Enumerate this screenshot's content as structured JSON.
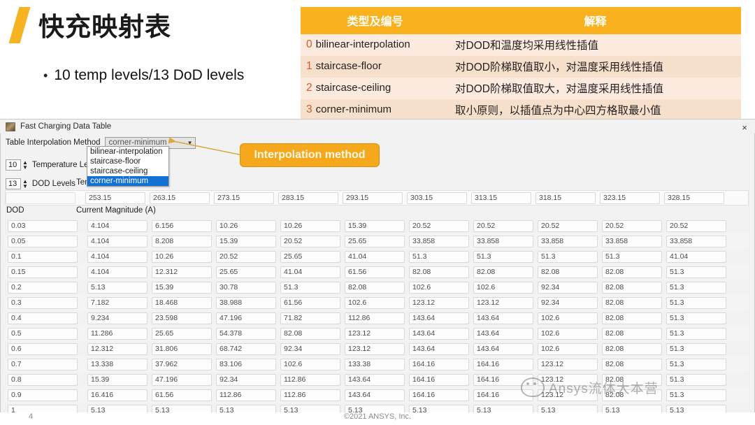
{
  "slide": {
    "title": "快充映射表",
    "bullet": "10 temp levels/13 DoD levels",
    "page_number": "4",
    "copyright": "©2021 ANSYS, Inc.",
    "accent_color": "#f6b221"
  },
  "legend": {
    "headers": [
      "类型及编号",
      "解释"
    ],
    "rows": [
      {
        "code": "0",
        "type": "bilinear-interpolation",
        "desc": "对DOD和温度均采用线性插值"
      },
      {
        "code": "1",
        "type": "staircase-floor",
        "desc": "对DOD阶梯取值取小，对温度采用线性插值"
      },
      {
        "code": "2",
        "type": "staircase-ceiling",
        "desc": "对DOD阶梯取值取大，对温度采用线性插值"
      },
      {
        "code": "3",
        "type": "corner-minimum",
        "desc": "取小原则，以插值点为中心四方格取最小值"
      }
    ],
    "header_bg": "#f9b11d",
    "code_color": "#d45c2a"
  },
  "app": {
    "title": "Fast Charging Data Table",
    "close_label": "×",
    "interp": {
      "label": "Table Interpolation Method",
      "value": "corner-minimum",
      "arrow": "▼",
      "options": [
        "bilinear-interpolation",
        "staircase-floor",
        "staircase-ceiling",
        "corner-minimum"
      ],
      "selected_option": "corner-minimum"
    },
    "temperature_levels": {
      "value": "10",
      "label": "Temperature Levels",
      "up": "▲",
      "down": "▼"
    },
    "dod_levels": {
      "value": "13",
      "label": "DOD Levels",
      "up": "▲",
      "down": "▼"
    },
    "grid_labels": {
      "temperature": "Temperature (K)",
      "dod": "DOD",
      "current_magnitude": "Current Magnitude (A)"
    }
  },
  "callout": {
    "text": "Interpolation method",
    "bg": "#f5a81c"
  },
  "watermark": {
    "text": "Ansys流体大本营"
  },
  "chart_data": {
    "type": "table",
    "title": "Fast Charging Data Table",
    "xlabel": "Temperature (K)",
    "ylabel": "DOD",
    "value_label": "Current Magnitude (A)",
    "categories": [
      "253.15",
      "263.15",
      "273.15",
      "283.15",
      "293.15",
      "303.15",
      "313.15",
      "318.15",
      "323.15",
      "328.15"
    ],
    "rows": [
      {
        "dod": "0.03",
        "values": [
          "4.104",
          "6.156",
          "10.26",
          "10.26",
          "15.39",
          "20.52",
          "20.52",
          "20.52",
          "20.52",
          "20.52"
        ]
      },
      {
        "dod": "0.05",
        "values": [
          "4.104",
          "8.208",
          "15.39",
          "20.52",
          "25.65",
          "33.858",
          "33.858",
          "33.858",
          "33.858",
          "33.858"
        ]
      },
      {
        "dod": "0.1",
        "values": [
          "4.104",
          "10.26",
          "20.52",
          "25.65",
          "41.04",
          "51.3",
          "51.3",
          "51.3",
          "51.3",
          "41.04"
        ]
      },
      {
        "dod": "0.15",
        "values": [
          "4.104",
          "12.312",
          "25.65",
          "41.04",
          "61.56",
          "82.08",
          "82.08",
          "82.08",
          "82.08",
          "51.3"
        ]
      },
      {
        "dod": "0.2",
        "values": [
          "5.13",
          "15.39",
          "30.78",
          "51.3",
          "82.08",
          "102.6",
          "102.6",
          "92.34",
          "82.08",
          "51.3"
        ]
      },
      {
        "dod": "0.3",
        "values": [
          "7.182",
          "18.468",
          "38.988",
          "61.56",
          "102.6",
          "123.12",
          "123.12",
          "92.34",
          "82.08",
          "51.3"
        ]
      },
      {
        "dod": "0.4",
        "values": [
          "9.234",
          "23.598",
          "47.196",
          "71.82",
          "112.86",
          "143.64",
          "143.64",
          "102.6",
          "82.08",
          "51.3"
        ]
      },
      {
        "dod": "0.5",
        "values": [
          "11.286",
          "25.65",
          "54.378",
          "82.08",
          "123.12",
          "143.64",
          "143.64",
          "102.6",
          "82.08",
          "51.3"
        ]
      },
      {
        "dod": "0.6",
        "values": [
          "12.312",
          "31.806",
          "68.742",
          "92.34",
          "123.12",
          "143.64",
          "143.64",
          "102.6",
          "82.08",
          "51.3"
        ]
      },
      {
        "dod": "0.7",
        "values": [
          "13.338",
          "37.962",
          "83.106",
          "102.6",
          "133.38",
          "164.16",
          "164.16",
          "123.12",
          "82.08",
          "51.3"
        ]
      },
      {
        "dod": "0.8",
        "values": [
          "15.39",
          "47.196",
          "92.34",
          "112.86",
          "143.64",
          "164.16",
          "164.16",
          "123.12",
          "82.08",
          "51.3"
        ]
      },
      {
        "dod": "0.9",
        "values": [
          "16.416",
          "61.56",
          "112.86",
          "112.86",
          "143.64",
          "164.16",
          "164.16",
          "123.12",
          "82.08",
          "51.3"
        ]
      },
      {
        "dod": "1",
        "values": [
          "5.13",
          "5.13",
          "5.13",
          "5.13",
          "5.13",
          "5.13",
          "5.13",
          "5.13",
          "5.13",
          "5.13"
        ]
      }
    ]
  }
}
